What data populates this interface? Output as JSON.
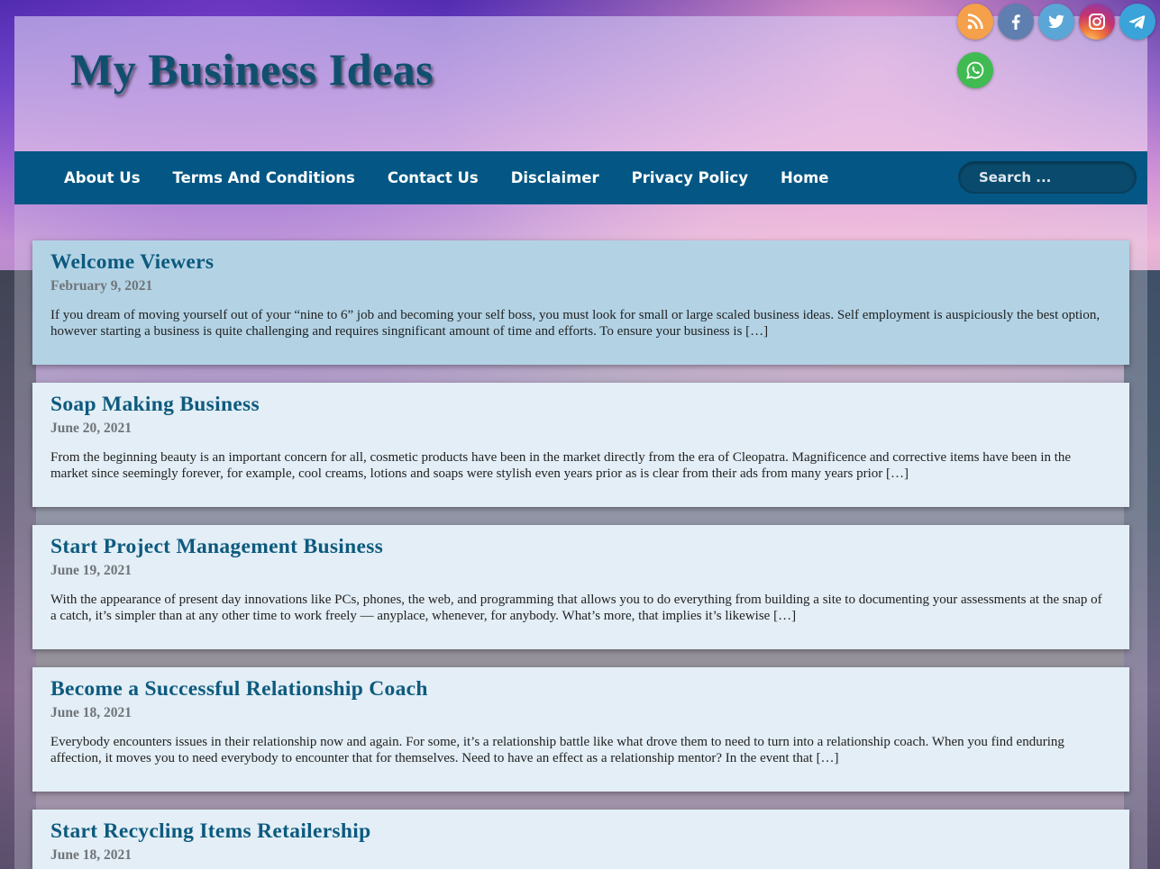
{
  "site": {
    "title": "My Business Ideas"
  },
  "social": [
    {
      "icon": "rss-icon",
      "color": "#f5a04a"
    },
    {
      "icon": "facebook-icon",
      "color": "#5f7fb0"
    },
    {
      "icon": "twitter-icon",
      "color": "#5aa6d6"
    },
    {
      "icon": "instagram-icon",
      "color": "#c6336f"
    },
    {
      "icon": "telegram-icon",
      "color": "#3aa3d9"
    },
    {
      "icon": "whatsapp-icon",
      "color": "#3fbb52"
    }
  ],
  "nav": {
    "items": [
      "About Us",
      "Terms And Conditions",
      "Contact Us",
      "Disclaimer",
      "Privacy Policy",
      "Home"
    ]
  },
  "search": {
    "placeholder": "Search ..."
  },
  "posts": [
    {
      "title": "Welcome Viewers",
      "date": "February 9, 2021",
      "excerpt": "If you dream of moving yourself out of your “nine to 6” job and becoming your self boss, you must look for small or large scaled business ideas. Self employment is auspiciously the best option, however starting a business is quite challenging and requires singnificant amount of time and efforts. To ensure your business is […]"
    },
    {
      "title": "Soap Making Business",
      "date": "June 20, 2021",
      "excerpt": "From the beginning beauty is an important concern for all, cosmetic products have been in the market directly from the era  of Cleopatra. Magnificence and corrective items have been in the market since seemingly forever, for example, cool creams, lotions and soaps were stylish even years prior as is clear from their ads from many years prior […]"
    },
    {
      "title": "Start Project Management Business",
      "date": "June 19, 2021",
      "excerpt": "With the appearance of present day innovations like PCs, phones, the web, and programming that allows you to do everything from building a site to documenting your assessments at the snap of a catch, it’s simpler than at any other time to work freely — anyplace, whenever, for anybody. What’s more, that implies it’s likewise […]"
    },
    {
      "title": "Become a Successful Relationship Coach",
      "date": "June 18, 2021",
      "excerpt": "Everybody encounters issues in their relationship now and again. For some, it’s a relationship battle like what drove them to need to turn into a relationship coach.  When you find enduring affection, it moves you to need everybody to encounter that for themselves. Need to have an effect as a relationship mentor? In the event that […]"
    },
    {
      "title": "Start Recycling Items Retailership",
      "date": "June 18, 2021",
      "excerpt": ""
    }
  ]
}
